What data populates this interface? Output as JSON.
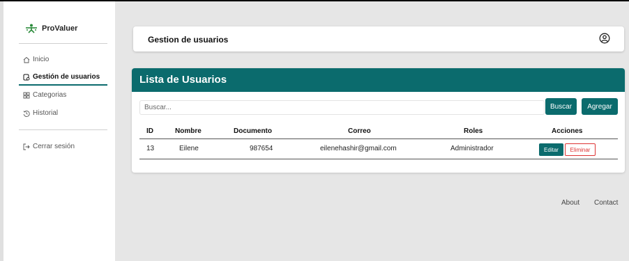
{
  "sidebar": {
    "brand": "ProValuer",
    "items": [
      {
        "label": "Inicio",
        "icon": "home-icon",
        "active": false
      },
      {
        "label": "Gestión de usuarios",
        "icon": "users-icon",
        "active": true
      },
      {
        "label": "Categorias",
        "icon": "grid-icon",
        "active": false
      },
      {
        "label": "Historial",
        "icon": "history-icon",
        "active": false
      }
    ],
    "logout": "Cerrar sesión"
  },
  "header": {
    "title": "Gestion de usuarios",
    "user_icon": "user-circle-icon"
  },
  "card": {
    "title": "Lista de Usuarios",
    "search_placeholder": "Buscar...",
    "buscar_label": "Buscar",
    "agregar_label": "Agregar"
  },
  "table": {
    "columns": [
      "ID",
      "Nombre",
      "Documento",
      "Correo",
      "Roles",
      "Acciones"
    ],
    "rows": [
      {
        "id": "13",
        "nombre": "Eilene",
        "documento": "987654",
        "correo": "eilenehashir@gmail.com",
        "rol": "Administrador",
        "edit_label": "Editar",
        "delete_label": "Eliminar"
      }
    ]
  },
  "footer": {
    "about": "About",
    "contact": "Contact"
  },
  "colors": {
    "accent": "#0b6b6d",
    "danger": "#dd3333",
    "background": "#e6e6e6"
  }
}
